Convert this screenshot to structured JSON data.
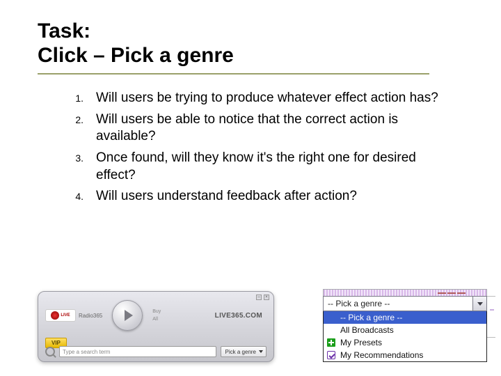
{
  "title": {
    "line1": "Task:",
    "line2": "Click – Pick a genre"
  },
  "questions": [
    {
      "num": "1.",
      "text": "Will users be trying to produce whatever effect action has?"
    },
    {
      "num": "2.",
      "text": "Will users be able to notice that the correct action is available?"
    },
    {
      "num": "3.",
      "text": "Once found, will they know it's the right one for desired effect?"
    },
    {
      "num": "4.",
      "text": "Will users understand feedback after action?"
    }
  ],
  "player": {
    "brand": "LIVE",
    "radio_label": "Radio365",
    "mid_labels": [
      "Buy",
      "All"
    ],
    "logo": "LIVE365.COM",
    "vip": "VIP",
    "search_placeholder": "Type a search term",
    "genre_button": "Pick a genre"
  },
  "dropdown": {
    "selected": "-- Pick a genre --",
    "options": [
      {
        "icon": "none",
        "label": "-- Pick a genre --",
        "selected": true
      },
      {
        "icon": "none",
        "label": "All Broadcasts",
        "selected": false
      },
      {
        "icon": "plus",
        "label": "My Presets",
        "selected": false
      },
      {
        "icon": "check",
        "label": "My Recommendations",
        "selected": false
      }
    ]
  }
}
